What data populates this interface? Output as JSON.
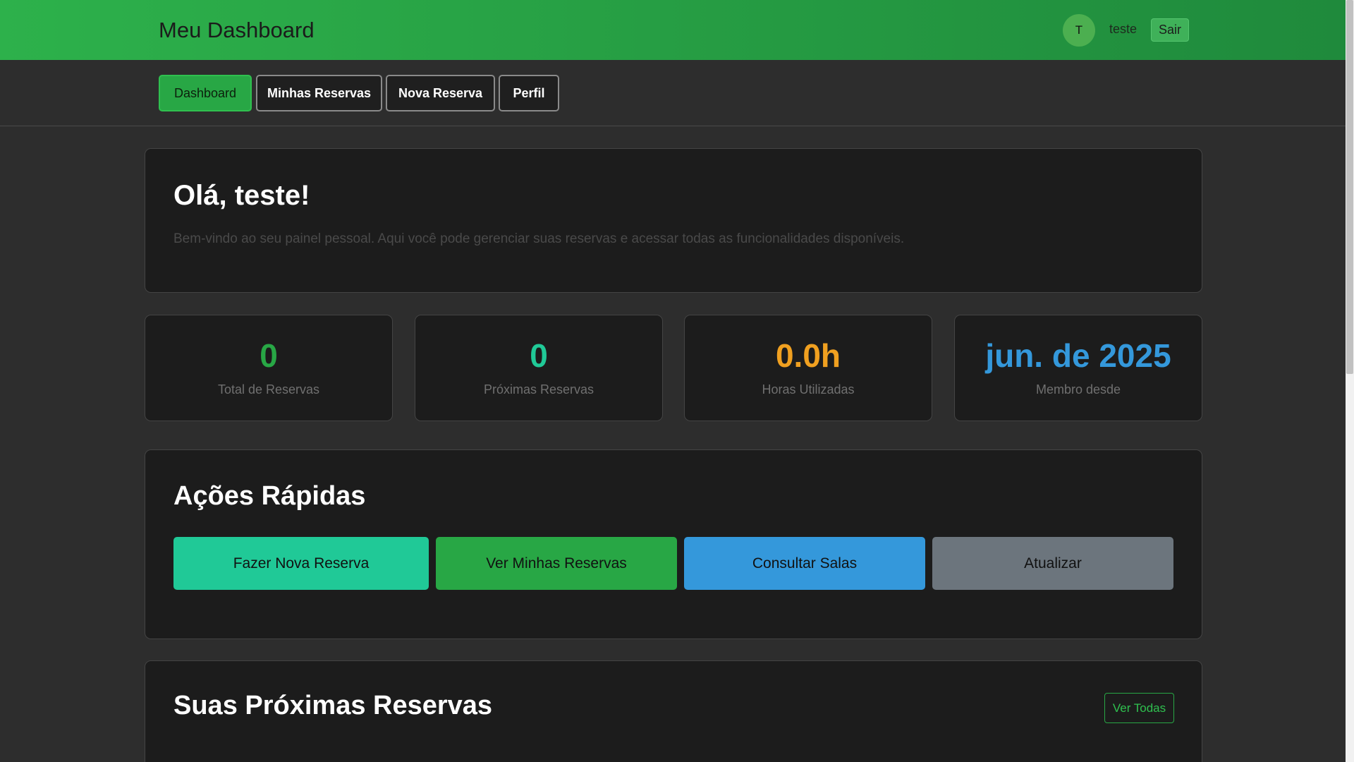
{
  "header": {
    "title": "Meu Dashboard",
    "avatar_initial": "T",
    "user_name": "teste",
    "logout_label": "Sair"
  },
  "nav": {
    "tabs": [
      {
        "label": "Dashboard",
        "active": true
      },
      {
        "label": "Minhas Reservas",
        "active": false
      },
      {
        "label": "Nova Reserva",
        "active": false
      },
      {
        "label": "Perfil",
        "active": false
      }
    ]
  },
  "welcome": {
    "title": "Olá, teste!",
    "text": "Bem-vindo ao seu painel pessoal. Aqui você pode gerenciar suas reservas e acessar todas as funcionalidades disponíveis."
  },
  "stats": [
    {
      "value": "0",
      "label": "Total de Reservas",
      "color": "#28a745"
    },
    {
      "value": "0",
      "label": "Próximas Reservas",
      "color": "#20c997"
    },
    {
      "value": "0.0h",
      "label": "Horas Utilizadas",
      "color": "#f0a020"
    },
    {
      "value": "jun. de 2025",
      "label": "Membro desde",
      "color": "#3498db"
    }
  ],
  "quick_actions": {
    "title": "Ações Rápidas",
    "buttons": [
      {
        "label": "Fazer Nova Reserva",
        "color": "#20c997"
      },
      {
        "label": "Ver Minhas Reservas",
        "color": "#28a745"
      },
      {
        "label": "Consultar Salas",
        "color": "#3498db"
      },
      {
        "label": "Atualizar",
        "color": "#6c757d"
      }
    ]
  },
  "upcoming": {
    "title": "Suas Próximas Reservas",
    "see_all_label": "Ver Todas"
  },
  "colors": {
    "header_start": "#2db14b",
    "header_end": "#1f8a3c",
    "background": "#2d2d2d",
    "card": "#1c1c1c"
  }
}
